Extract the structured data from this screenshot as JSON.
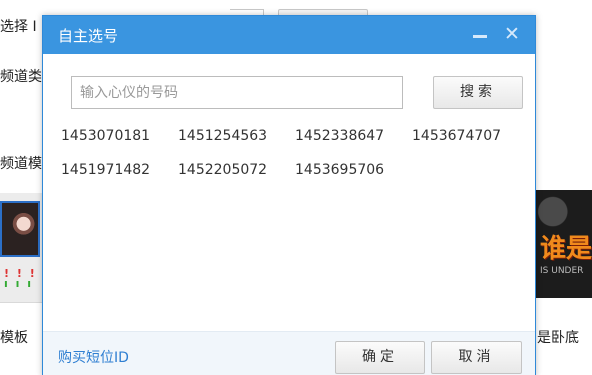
{
  "background": {
    "label_select": "选择 I",
    "label_channel_type": "频道类",
    "label_channel_template": "频道模",
    "label_template": "模板",
    "label_right_caption": "是卧底",
    "right_thumb_text": "谁是卧",
    "right_thumb_sub": "IS UNDER"
  },
  "dialog": {
    "title": "自主选号",
    "search": {
      "placeholder": "输入心仪的号码",
      "value": "",
      "button_label": "搜索"
    },
    "numbers": [
      [
        "1453070181",
        "1451254563",
        "1452338647",
        "1453674707"
      ],
      [
        "1451971482",
        "1452205072",
        "1453695706"
      ]
    ],
    "footer": {
      "buy_link": "购买短位ID",
      "ok_label": "确定",
      "cancel_label": "取消"
    }
  },
  "colors": {
    "header": "#3a95e0",
    "link": "#2f7fd2",
    "footer_bg": "#f1f6fb"
  }
}
